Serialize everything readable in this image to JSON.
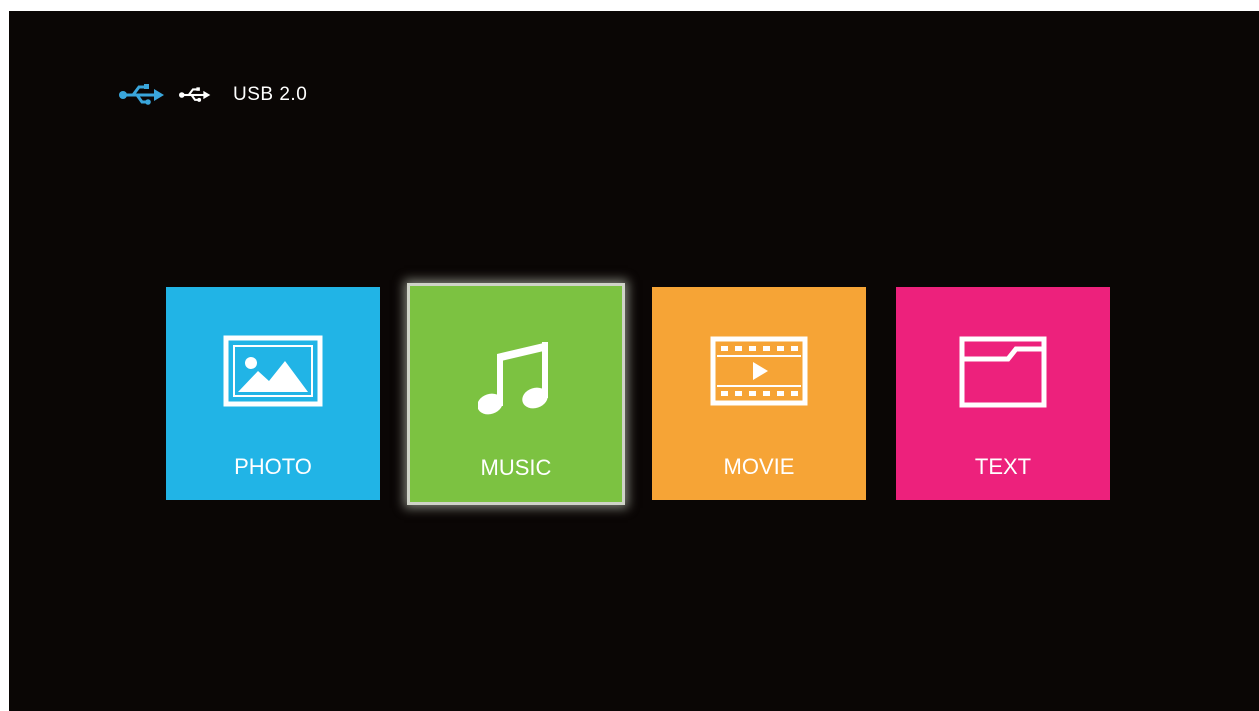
{
  "status": {
    "device_label": "USB 2.0",
    "icons": [
      "usb-icon",
      "usb-icon"
    ],
    "usb_icon_color": "#3aa6dc"
  },
  "menu": {
    "focused": "MUSIC",
    "tiles": [
      {
        "id": "photo",
        "label": "PHOTO",
        "icon": "image-icon",
        "color": "#21b4e6"
      },
      {
        "id": "music",
        "label": "MUSIC",
        "icon": "music-note-icon",
        "color": "#7cc241"
      },
      {
        "id": "movie",
        "label": "MOVIE",
        "icon": "film-icon",
        "color": "#f6a436"
      },
      {
        "id": "text",
        "label": "TEXT",
        "icon": "folder-icon",
        "color": "#ed217c"
      }
    ]
  }
}
